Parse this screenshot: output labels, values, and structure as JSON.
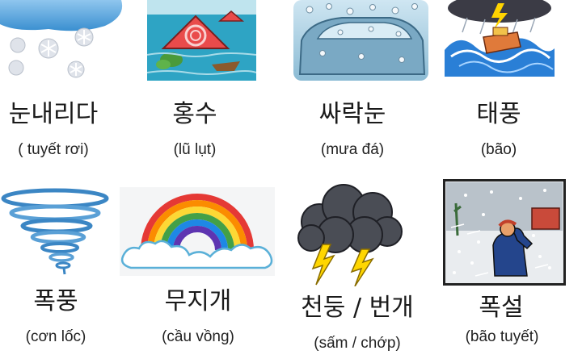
{
  "items": [
    {
      "korean": "눈내리다",
      "vietnamese": "( tuyết rơi)",
      "icon": "snowing-cloud-icon"
    },
    {
      "korean": "홍수",
      "vietnamese": "(lũ lụt)",
      "icon": "flood-house-icon"
    },
    {
      "korean": "싸락눈",
      "vietnamese": "(mưa đá)",
      "icon": "hail-car-icon"
    },
    {
      "korean": "태풍",
      "vietnamese": "(bão)",
      "icon": "storm-ship-icon"
    },
    {
      "korean": "폭풍",
      "vietnamese": "(cơn lốc)",
      "icon": "tornado-icon"
    },
    {
      "korean": "무지개",
      "vietnamese": "(cầu vồng)",
      "icon": "rainbow-icon"
    },
    {
      "korean": "천둥 / 번개",
      "vietnamese": "(sấm / chớp)",
      "icon": "thunder-cloud-icon"
    },
    {
      "korean": "폭설",
      "vietnamese": "(bão tuyết)",
      "icon": "blizzard-person-icon"
    }
  ]
}
